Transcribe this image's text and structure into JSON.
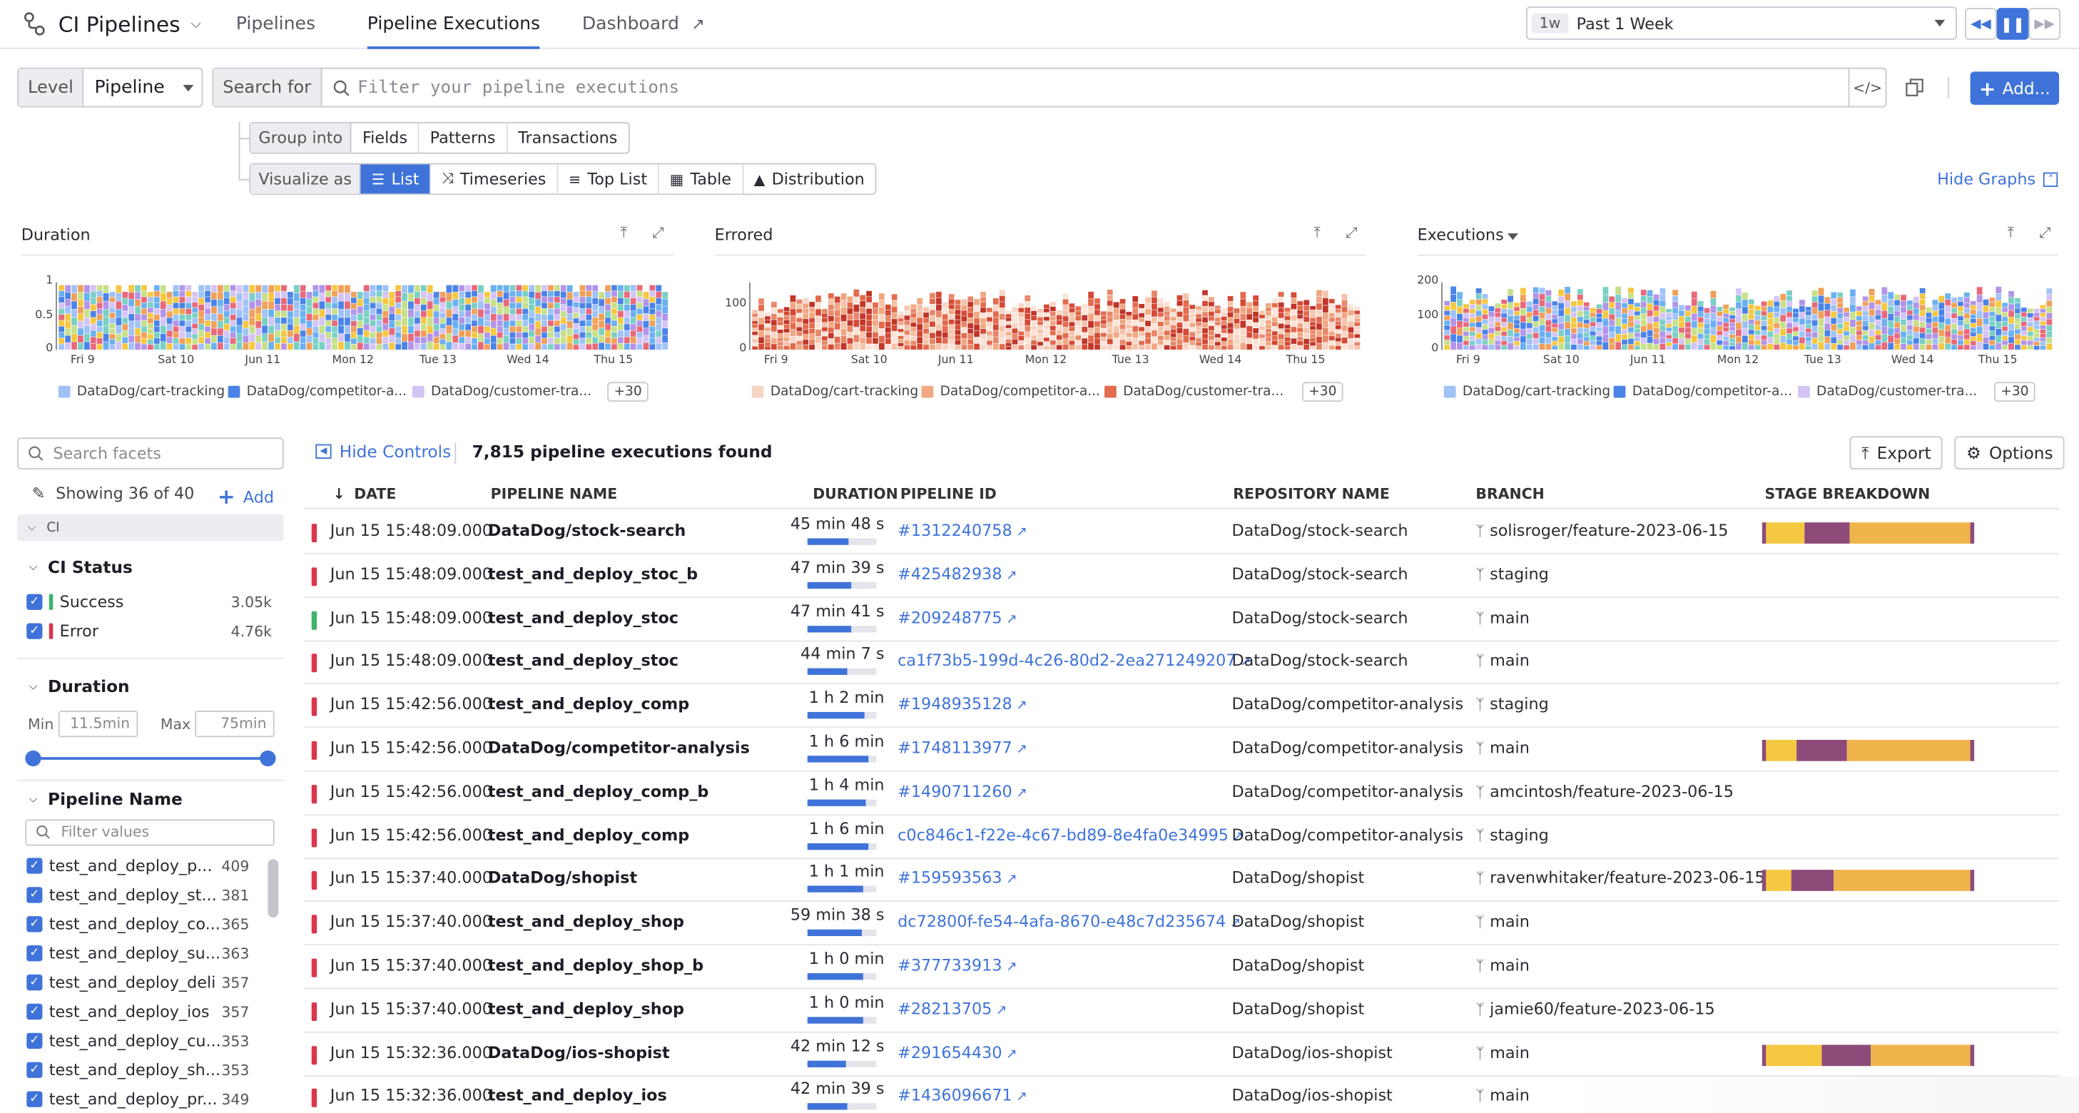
{
  "header": {
    "app_title": "CI Pipelines",
    "tabs": [
      {
        "label": "Pipelines",
        "active": false
      },
      {
        "label": "Pipeline Executions",
        "active": true
      },
      {
        "label": "Dashboard",
        "active": false
      }
    ],
    "time": {
      "chip": "1w",
      "label": "Past 1 Week"
    }
  },
  "search": {
    "level_label": "Level",
    "level_value": "Pipeline",
    "search_label": "Search for",
    "placeholder": "Filter your pipeline executions",
    "add_label": "Add..."
  },
  "group": {
    "label": "Group into",
    "options": [
      "Fields",
      "Patterns",
      "Transactions"
    ]
  },
  "visualize": {
    "label": "Visualize as",
    "options": [
      {
        "label": "List",
        "icon": "list-icon",
        "active": true
      },
      {
        "label": "Timeseries",
        "icon": "timeseries-icon",
        "active": false
      },
      {
        "label": "Top List",
        "icon": "toplist-icon",
        "active": false
      },
      {
        "label": "Table",
        "icon": "table-icon",
        "active": false
      },
      {
        "label": "Distribution",
        "icon": "distribution-icon",
        "active": false
      }
    ]
  },
  "hide_graphs": "Hide Graphs",
  "colors": {
    "accent": "#3f73d9",
    "success": "#3fb36d",
    "error": "#d9364b",
    "stage_yellow": "#f5c842",
    "stage_purple": "#8e4b7a",
    "stage_orange": "#f0b44d"
  },
  "chart_data": [
    {
      "type": "bar",
      "title": "Duration",
      "x_ticks": [
        "Fri 9",
        "Sat 10",
        "Jun 11",
        "Mon 12",
        "Tue 13",
        "Wed 14",
        "Thu 15"
      ],
      "y_ticks": [
        "1",
        "0.5",
        "0"
      ],
      "ylim": [
        0,
        1
      ],
      "legend": [
        "DataDog/cart-tracking",
        "DataDog/competitor-a...",
        "DataDog/customer-tra..."
      ],
      "legend_more": "+30",
      "series_colors": [
        "#9fc2f7",
        "#4b83e8",
        "#d4c3f5"
      ]
    },
    {
      "type": "bar",
      "title": "Errored",
      "x_ticks": [
        "Fri 9",
        "Sat 10",
        "Jun 11",
        "Mon 12",
        "Tue 13",
        "Wed 14",
        "Thu 15"
      ],
      "y_ticks": [
        "100",
        "0"
      ],
      "ylim": [
        0,
        150
      ],
      "legend": [
        "DataDog/cart-tracking",
        "DataDog/competitor-a...",
        "DataDog/customer-tra..."
      ],
      "legend_more": "+30",
      "series_colors": [
        "#f8d6c6",
        "#f0a882",
        "#e36b4e"
      ]
    },
    {
      "type": "bar",
      "title": "Executions",
      "x_ticks": [
        "Fri 9",
        "Sat 10",
        "Jun 11",
        "Mon 12",
        "Tue 13",
        "Wed 14",
        "Thu 15"
      ],
      "y_ticks": [
        "200",
        "100",
        "0"
      ],
      "ylim": [
        0,
        200
      ],
      "legend": [
        "DataDog/cart-tracking",
        "DataDog/competitor-a...",
        "DataDog/customer-tra..."
      ],
      "legend_more": "+30",
      "series_colors": [
        "#9fc2f7",
        "#4b83e8",
        "#d4c3f5"
      ]
    }
  ],
  "facets": {
    "search_placeholder": "Search facets",
    "showing": "Showing 36 of 40",
    "add_label": "Add",
    "section_ci": "CI",
    "ci_status": {
      "title": "CI Status",
      "items": [
        {
          "label": "Success",
          "count": "3.05k",
          "color": "#3fb36d"
        },
        {
          "label": "Error",
          "count": "4.76k",
          "color": "#d9364b"
        }
      ]
    },
    "duration": {
      "title": "Duration",
      "min_label": "Min",
      "min_value": "11.5min",
      "max_label": "Max",
      "max_value": "75min"
    },
    "pipeline_name": {
      "title": "Pipeline Name",
      "filter_placeholder": "Filter values",
      "items": [
        {
          "label": "test_and_deploy_p...",
          "count": "409"
        },
        {
          "label": "test_and_deploy_st...",
          "count": "381"
        },
        {
          "label": "test_and_deploy_co...",
          "count": "365"
        },
        {
          "label": "test_and_deploy_su...",
          "count": "363"
        },
        {
          "label": "test_and_deploy_deli",
          "count": "357"
        },
        {
          "label": "test_and_deploy_ios",
          "count": "357"
        },
        {
          "label": "test_and_deploy_cu...",
          "count": "353"
        },
        {
          "label": "test_and_deploy_sh...",
          "count": "353"
        },
        {
          "label": "test_and_deploy_pr...",
          "count": "349"
        }
      ]
    }
  },
  "list": {
    "hide_controls": "Hide Controls",
    "found": "7,815 pipeline executions found",
    "export": "Export",
    "options": "Options",
    "columns": [
      "DATE",
      "PIPELINE NAME",
      "DURATION",
      "PIPELINE ID",
      "REPOSITORY NAME",
      "BRANCH",
      "STAGE BREAKDOWN"
    ],
    "rows": [
      {
        "status": "error",
        "date": "Jun 15 15:48:09.000",
        "name": "DataDog/stock-search",
        "duration": "45 min 48 s",
        "dur_frac": 0.6,
        "pid": "#1312240758",
        "repo": "DataDog/stock-search",
        "branch": "solisroger/feature-2023-06-15",
        "stages": [
          0.02,
          0.18,
          0.21,
          0.57,
          0.02
        ]
      },
      {
        "status": "error",
        "date": "Jun 15 15:48:09.000",
        "name": "test_and_deploy_stoc_b",
        "duration": "47 min 39 s",
        "dur_frac": 0.63,
        "pid": "#425482938",
        "repo": "DataDog/stock-search",
        "branch": "staging",
        "stages": []
      },
      {
        "status": "success",
        "date": "Jun 15 15:48:09.000",
        "name": "test_and_deploy_stoc",
        "duration": "47 min 41 s",
        "dur_frac": 0.63,
        "pid": "#209248775",
        "repo": "DataDog/stock-search",
        "branch": "main",
        "stages": []
      },
      {
        "status": "error",
        "date": "Jun 15 15:48:09.000",
        "name": "test_and_deploy_stoc",
        "duration": "44 min 7 s",
        "dur_frac": 0.58,
        "pid": "ca1f73b5-199d-4c26-80d2-2ea271249207",
        "repo": "DataDog/stock-search",
        "branch": "main",
        "stages": []
      },
      {
        "status": "error",
        "date": "Jun 15 15:42:56.000",
        "name": "test_and_deploy_comp",
        "duration": "1 h 2 min",
        "dur_frac": 0.82,
        "pid": "#1948935128",
        "repo": "DataDog/competitor-analysis",
        "branch": "staging",
        "stages": []
      },
      {
        "status": "error",
        "date": "Jun 15 15:42:56.000",
        "name": "DataDog/competitor-analysis",
        "duration": "1 h 6 min",
        "dur_frac": 0.88,
        "pid": "#1748113977",
        "repo": "DataDog/competitor-analysis",
        "branch": "main",
        "stages": [
          0.02,
          0.14,
          0.24,
          0.58,
          0.02
        ]
      },
      {
        "status": "error",
        "date": "Jun 15 15:42:56.000",
        "name": "test_and_deploy_comp_b",
        "duration": "1 h 4 min",
        "dur_frac": 0.85,
        "pid": "#1490711260",
        "repo": "DataDog/competitor-analysis",
        "branch": "amcintosh/feature-2023-06-15",
        "stages": []
      },
      {
        "status": "error",
        "date": "Jun 15 15:42:56.000",
        "name": "test_and_deploy_comp",
        "duration": "1 h 6 min",
        "dur_frac": 0.88,
        "pid": "c0c846c1-f22e-4c67-bd89-8e4fa0e34995",
        "repo": "DataDog/competitor-analysis",
        "branch": "staging",
        "stages": []
      },
      {
        "status": "error",
        "date": "Jun 15 15:37:40.000",
        "name": "DataDog/shopist",
        "duration": "1 h 1 min",
        "dur_frac": 0.81,
        "pid": "#159593563",
        "repo": "DataDog/shopist",
        "branch": "ravenwhitaker/feature-2023-06-15",
        "stages": [
          0.02,
          0.12,
          0.2,
          0.64,
          0.02
        ]
      },
      {
        "status": "error",
        "date": "Jun 15 15:37:40.000",
        "name": "test_and_deploy_shop",
        "duration": "59 min 38 s",
        "dur_frac": 0.79,
        "pid": "dc72800f-fe54-4afa-8670-e48c7d235674",
        "repo": "DataDog/shopist",
        "branch": "main",
        "stages": []
      },
      {
        "status": "error",
        "date": "Jun 15 15:37:40.000",
        "name": "test_and_deploy_shop_b",
        "duration": "1 h 0 min",
        "dur_frac": 0.8,
        "pid": "#377733913",
        "repo": "DataDog/shopist",
        "branch": "main",
        "stages": []
      },
      {
        "status": "error",
        "date": "Jun 15 15:37:40.000",
        "name": "test_and_deploy_shop",
        "duration": "1 h 0 min",
        "dur_frac": 0.8,
        "pid": "#28213705",
        "repo": "DataDog/shopist",
        "branch": "jamie60/feature-2023-06-15",
        "stages": []
      },
      {
        "status": "error",
        "date": "Jun 15 15:32:36.000",
        "name": "DataDog/ios-shopist",
        "duration": "42 min 12 s",
        "dur_frac": 0.56,
        "pid": "#291654430",
        "repo": "DataDog/ios-shopist",
        "branch": "main",
        "stages": [
          0.02,
          0.26,
          0.23,
          0.47,
          0.02
        ]
      },
      {
        "status": "error",
        "date": "Jun 15 15:32:36.000",
        "name": "test_and_deploy_ios",
        "duration": "42 min 39 s",
        "dur_frac": 0.57,
        "pid": "#1436096671",
        "repo": "DataDog/ios-shopist",
        "branch": "main",
        "stages": []
      }
    ]
  }
}
